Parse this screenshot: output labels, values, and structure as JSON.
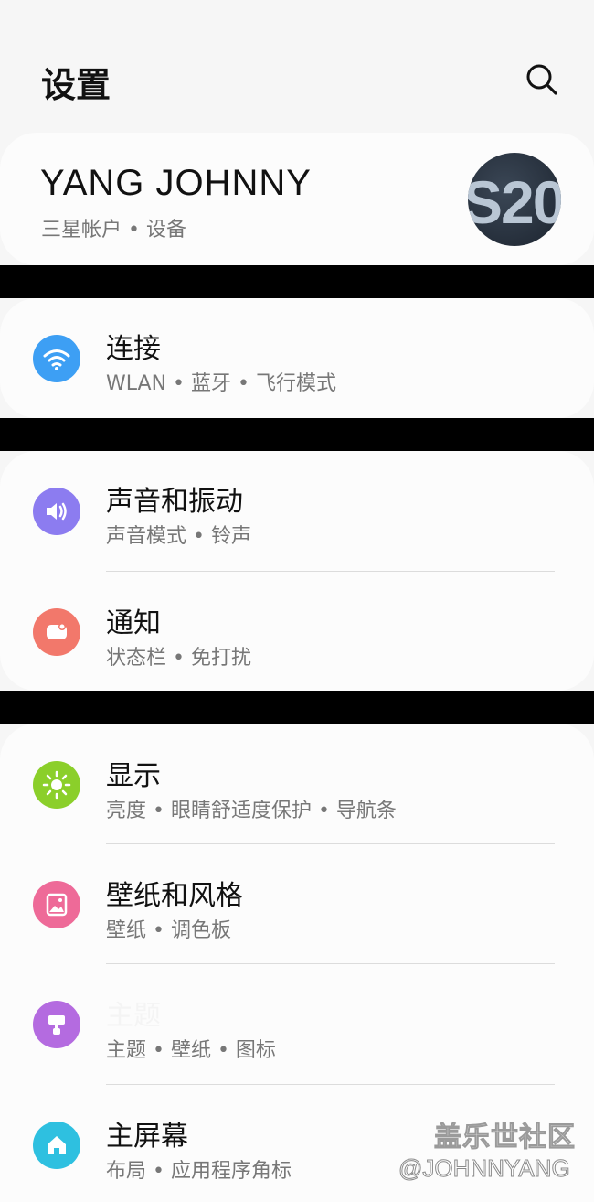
{
  "header": {
    "title": "设置"
  },
  "account": {
    "name": "YANG JOHNNY",
    "subtitle": "三星帐户 • 设备",
    "avatar_text": "S20"
  },
  "groups": [
    {
      "items": [
        {
          "title": "连接",
          "subtitle": "WLAN • 蓝牙 • 飞行模式",
          "icon": "wifi-icon",
          "color": "#3d9ff4"
        }
      ]
    },
    {
      "items": [
        {
          "title": "声音和振动",
          "subtitle": "声音模式 • 铃声",
          "icon": "volume-icon",
          "color": "#8c7cf0"
        },
        {
          "title": "通知",
          "subtitle": "状态栏 • 免打扰",
          "icon": "notification-icon",
          "color": "#f2786b"
        }
      ]
    },
    {
      "items": [
        {
          "title": "显示",
          "subtitle": "亮度 • 眼睛舒适度保护 • 导航条",
          "icon": "brightness-icon",
          "color": "#8bcf2a"
        },
        {
          "title": "壁纸和风格",
          "subtitle": "壁纸 • 调色板",
          "icon": "wallpaper-icon",
          "color": "#ee6a98"
        },
        {
          "title": "主题",
          "subtitle": "主题 • 壁纸 • 图标",
          "icon": "theme-brush-icon",
          "color": "#b46be0"
        },
        {
          "title": "主屏幕",
          "subtitle": "布局 • 应用程序角标",
          "icon": "home-icon",
          "color": "#2ec0e0"
        }
      ]
    }
  ],
  "watermark": {
    "line1": "盖乐世社区",
    "line2": "@JOHNNYANG"
  }
}
